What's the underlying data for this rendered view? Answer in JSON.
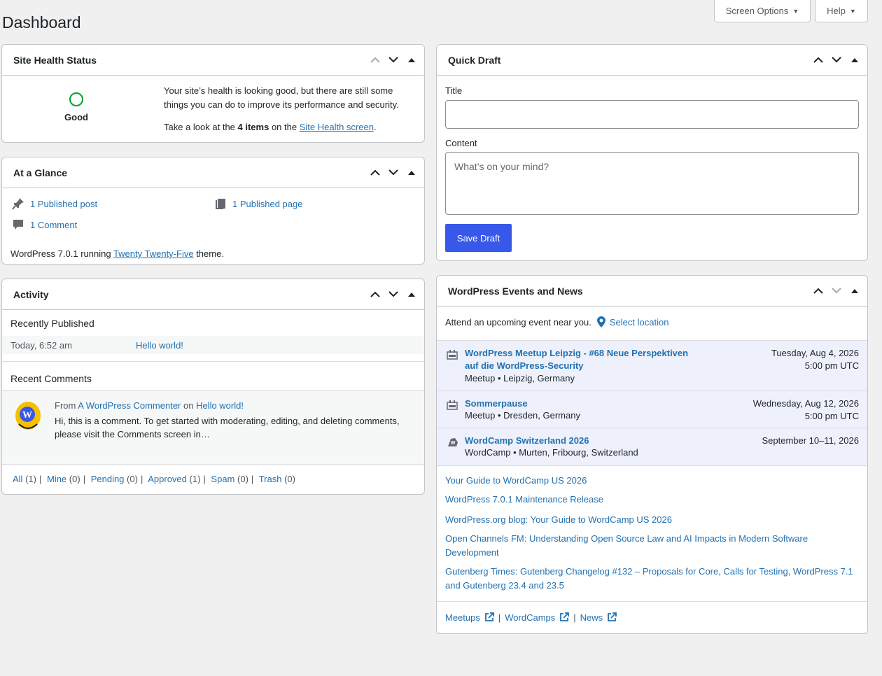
{
  "page": {
    "title": "Dashboard"
  },
  "screen_meta": {
    "screen_options": "Screen Options",
    "help": "Help"
  },
  "site_health": {
    "title": "Site Health Status",
    "status": "Good",
    "message": "Your site’s health is looking good, but there are still some things you can do to improve its performance and security.",
    "cta_prefix": "Take a look at the ",
    "cta_count": "4 items",
    "cta_mid": " on the ",
    "cta_link": "Site Health screen",
    "cta_suffix": "."
  },
  "glance": {
    "title": "At a Glance",
    "posts": "1 Published post",
    "pages": "1 Published page",
    "comments": "1 Comment",
    "footer_prefix": "WordPress 7.0.1 running ",
    "theme": "Twenty Twenty-Five",
    "footer_suffix": " theme."
  },
  "activity": {
    "title": "Activity",
    "recently_published": "Recently Published",
    "published": [
      {
        "date": "Today, 6:52 am",
        "title": "Hello world!"
      }
    ],
    "recent_comments": "Recent Comments",
    "comment": {
      "from": "From ",
      "author": "A WordPress Commenter",
      "on": " on ",
      "post": "Hello world!",
      "excerpt": "Hi, this is a comment. To get started with moderating, editing, and deleting comments, please visit the Comments screen in…"
    },
    "filters": [
      {
        "label": "All",
        "count": "(1)"
      },
      {
        "label": "Mine",
        "count": "(0)"
      },
      {
        "label": "Pending",
        "count": "(0)"
      },
      {
        "label": "Approved",
        "count": "(1)"
      },
      {
        "label": "Spam",
        "count": "(0)"
      },
      {
        "label": "Trash",
        "count": "(0)"
      }
    ]
  },
  "quick_draft": {
    "title": "Quick Draft",
    "title_label": "Title",
    "title_value": "",
    "content_label": "Content",
    "content_placeholder": "What’s on your mind?",
    "save_label": "Save Draft"
  },
  "events": {
    "title": "WordPress Events and News",
    "attend": "Attend an upcoming event near you.",
    "select_location": "Select location",
    "items": [
      {
        "title": "WordPress Meetup Leipzig - #68 Neue Perspektiven auf die WordPress-Security",
        "meta": "Meetup • Leipzig, Germany",
        "date": "Tuesday, Aug 4, 2026",
        "time": "5:00 pm UTC",
        "icon": "meetup-icon"
      },
      {
        "title": "Sommerpause",
        "meta": "Meetup • Dresden, Germany",
        "date": "Wednesday, Aug 12, 2026",
        "time": "5:00 pm UTC",
        "icon": "meetup-icon"
      },
      {
        "title": "WordCamp Switzerland 2026",
        "meta": "WordCamp • Murten, Fribourg, Switzerland",
        "date": "September 10–11, 2026",
        "time": "",
        "icon": "wordcamp-icon"
      }
    ],
    "news": [
      "Your Guide to WordCamp US 2026",
      "WordPress 7.0.1 Maintenance Release",
      "WordPress.org blog: Your Guide to WordCamp US 2026",
      "Open Channels FM: Understanding Open Source Law and AI Impacts in Modern Software Development",
      "Gutenberg Times: Gutenberg Changelog #132 – Proposals for Core, Calls for Testing, WordPress 7.1 and Gutenberg 23.4 and 23.5"
    ],
    "footer": {
      "meetups": "Meetups",
      "wordcamps": "WordCamps",
      "news": "News",
      "sep": "|"
    }
  },
  "colors": {
    "accent": "#3858e9",
    "link": "#2271b1",
    "good": "#00a32a",
    "event_bg": "#eef1fb"
  },
  "icons": {
    "up": "chevron-up-icon",
    "down": "chevron-down-icon",
    "toggle": "triangle-up-icon",
    "pin": "pin-icon",
    "pages": "pages-icon",
    "comment": "comment-icon",
    "location": "location-pin-icon",
    "external": "external-link-icon"
  }
}
